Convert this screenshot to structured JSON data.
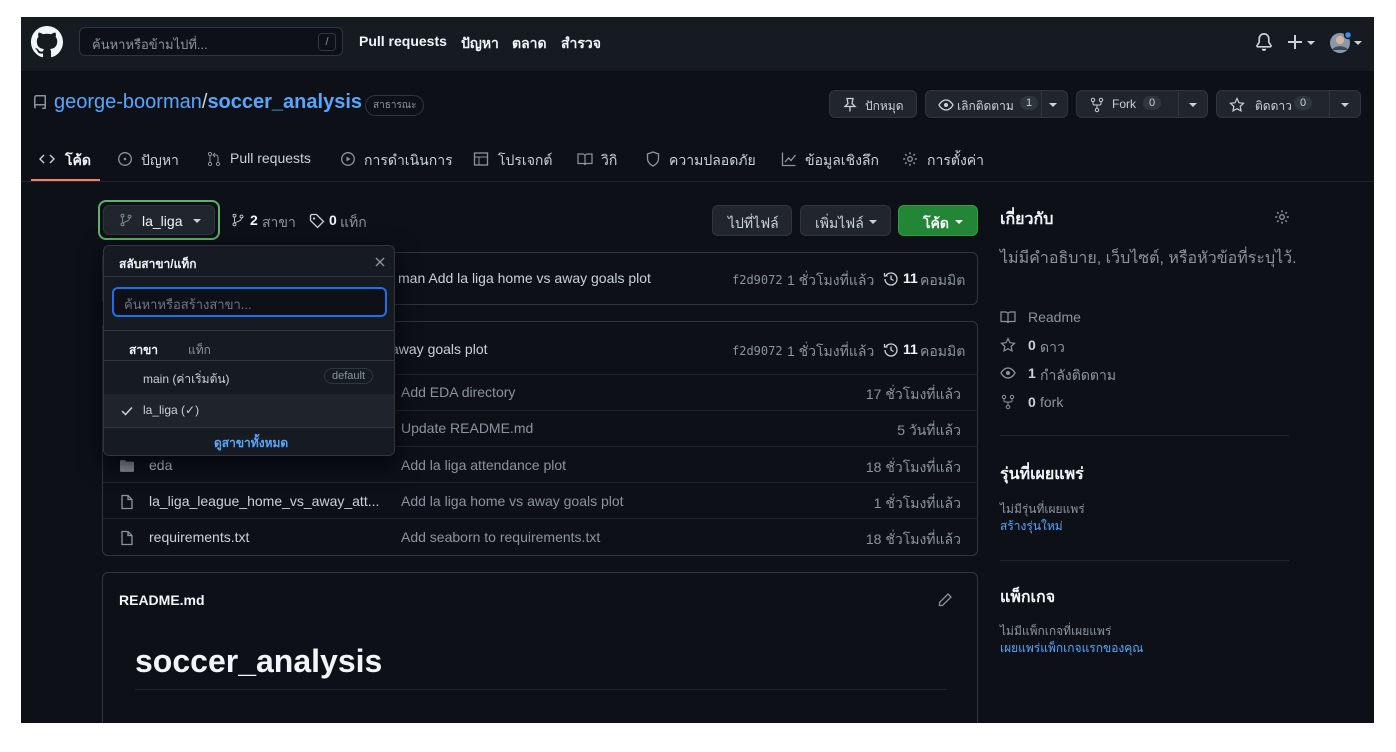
{
  "header": {
    "search_placeholder": "ค้นหาหรือข้ามไปที่...",
    "slash_key": "/",
    "nav": [
      "Pull requests",
      "ปัญหา",
      "ตลาด",
      "สำรวจ"
    ]
  },
  "repo": {
    "owner": "george-boorman",
    "separator": "/",
    "name": "soccer_analysis",
    "visibility": "สาธารณะ",
    "pin_label": "ปักหมุด",
    "unwatch_label": "เลิกติดตาม",
    "watch_count": "1",
    "fork_label": "Fork",
    "fork_count": "0",
    "star_label": "ติดดาว",
    "star_count": "0"
  },
  "tabs": [
    {
      "label": "โค้ด",
      "icon": "code-icon",
      "active": true
    },
    {
      "label": "ปัญหา",
      "icon": "issue-icon"
    },
    {
      "label": "Pull requests",
      "icon": "pull-request-icon"
    },
    {
      "label": "การดำเนินการ",
      "icon": "play-icon"
    },
    {
      "label": "โปรเจกต์",
      "icon": "table-icon"
    },
    {
      "label": "วิกิ",
      "icon": "book-icon"
    },
    {
      "label": "ความปลอดภัย",
      "icon": "shield-icon"
    },
    {
      "label": "ข้อมูลเชิงลึก",
      "icon": "graph-icon"
    },
    {
      "label": "การตั้งค่า",
      "icon": "gear-icon"
    }
  ],
  "toolbar": {
    "branch": "la_liga",
    "branches_count": "2",
    "branches_label": "สาขา",
    "tags_count": "0",
    "tags_label": "แท็ก",
    "goto_file": "ไปที่ไฟล์",
    "add_file": "เพิ่มไฟล์",
    "code": "โค้ด"
  },
  "latest_commit": {
    "message_tail": "man Add la liga home vs away goals plot",
    "hash": "f2d9072",
    "time": "1 ชั่วโมงที่แล้ว",
    "commits_count": "11",
    "commits_label": "คอมมิต"
  },
  "branch_commit": {
    "message_tail": "away goals plot",
    "hash": "f2d9072",
    "time": "1 ชั่วโมงที่แล้ว",
    "commits_count": "11",
    "commits_label": "คอมมิต"
  },
  "files": [
    {
      "name": "",
      "type": "folder",
      "message": "Add EDA directory",
      "time": "17 ชั่วโมงที่แล้ว"
    },
    {
      "name": "",
      "type": "file",
      "message": "Update README.md",
      "time": "5 วันที่แล้ว"
    },
    {
      "name": "eda",
      "type": "folder",
      "message": "Add la liga attendance plot",
      "time": "18 ชั่วโมงที่แล้ว"
    },
    {
      "name": "la_liga_league_home_vs_away_att...",
      "type": "file",
      "message": "Add la liga home vs away goals plot",
      "time": "1 ชั่วโมงที่แล้ว"
    },
    {
      "name": "requirements.txt",
      "type": "file",
      "message": "Add seaborn to requirements.txt",
      "time": "18 ชั่วโมงที่แล้ว"
    }
  ],
  "readme": {
    "filename": "README.md",
    "heading": "soccer_analysis"
  },
  "dropdown": {
    "title": "สลับสาขา/แท็ก",
    "filter_placeholder": "ค้นหาหรือสร้างสาขา...",
    "tab_branches": "สาขา",
    "tab_tags": "แท็ก",
    "items": [
      {
        "label": "main (ค่าเริ่มต้น)",
        "badge": "default",
        "selected": false
      },
      {
        "label": "la_liga (✓)",
        "badge": "",
        "selected": true
      }
    ],
    "view_all": "ดูสาขาทั้งหมด"
  },
  "sidebar": {
    "about_title": "เกี่ยวกับ",
    "about_desc": "ไม่มีคำอธิบาย, เว็บไซต์, หรือหัวข้อที่ระบุไว้.",
    "readme": "Readme",
    "stars_count": "0",
    "stars_label": "ดาว",
    "watching_count": "1",
    "watching_label": "กำลังติดตาม",
    "forks_count": "0",
    "forks_label": "fork",
    "releases_title": "รุ่นที่เผยแพร่",
    "releases_none": "ไม่มีรุ่นที่เผยแพร่",
    "releases_link": "สร้างรุ่นใหม่",
    "packages_title": "แพ็กเกจ",
    "packages_none": "ไม่มีแพ็กเกจที่เผยแพร่",
    "packages_link": "เผยแพร่แพ็กเกจแรกของคุณ"
  },
  "colors": {
    "background": "#0d1117",
    "header": "#161b22",
    "accent_link": "#58a6ff",
    "code_button": "#238636",
    "active_tab": "#f78166",
    "branch_focus": "#7ee787"
  }
}
